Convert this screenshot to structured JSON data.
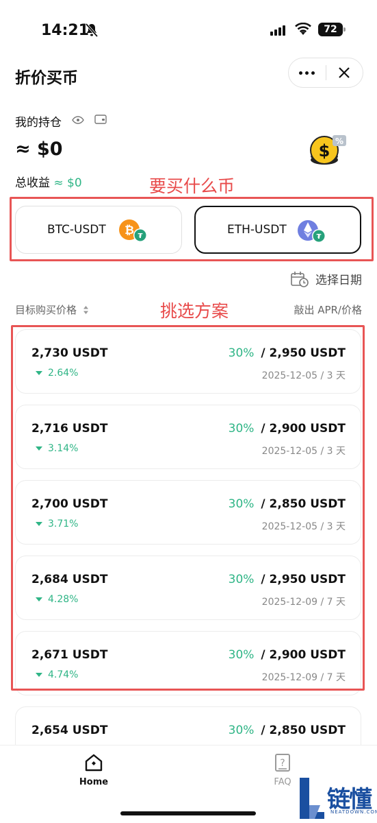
{
  "status_bar": {
    "time": "14:21",
    "battery": "72"
  },
  "header": {
    "title": "折价买币"
  },
  "holdings": {
    "label": "我的持仓",
    "amount": "≈ $0",
    "pnl_label": "总收益",
    "pnl_value": "≈ $0"
  },
  "annotations": {
    "pick_coin": "要买什么币",
    "pick_plan": "挑选方案"
  },
  "pairs": [
    {
      "label": "BTC-USDT",
      "icon": "btc-usdt-icon",
      "selected": false
    },
    {
      "label": "ETH-USDT",
      "icon": "eth-usdt-icon",
      "selected": true
    }
  ],
  "date_filter": {
    "label": "选择日期"
  },
  "list_header": {
    "left": "目标购买价格",
    "right": "敲出 APR/价格"
  },
  "plans": [
    {
      "price": "2,730 USDT",
      "change": "2.64%",
      "apr": "30%",
      "knock_out": "/ 2,950 USDT",
      "date": "2025-12-05 / 3 天"
    },
    {
      "price": "2,716 USDT",
      "change": "3.14%",
      "apr": "30%",
      "knock_out": "/ 2,900 USDT",
      "date": "2025-12-05 / 3 天"
    },
    {
      "price": "2,700 USDT",
      "change": "3.71%",
      "apr": "30%",
      "knock_out": "/ 2,850 USDT",
      "date": "2025-12-05 / 3 天"
    },
    {
      "price": "2,684 USDT",
      "change": "4.28%",
      "apr": "30%",
      "knock_out": "/ 2,950 USDT",
      "date": "2025-12-09 / 7 天"
    },
    {
      "price": "2,671 USDT",
      "change": "4.74%",
      "apr": "30%",
      "knock_out": "/ 2,900 USDT",
      "date": "2025-12-09 / 7 天"
    },
    {
      "price": "2,654 USDT",
      "change": "",
      "apr": "30%",
      "knock_out": "/ 2,850 USDT",
      "date": ""
    }
  ],
  "tabs": [
    {
      "label": "Home",
      "icon": "home-icon",
      "active": true
    },
    {
      "label": "FAQ",
      "icon": "faq-icon",
      "active": false
    }
  ],
  "watermark": {
    "title": "链懂",
    "sub": "NEATDOWN.COM"
  },
  "colors": {
    "accent_green": "#2fb586",
    "annotation_red": "#e85555",
    "brand_blue": "#1a4fa0"
  }
}
